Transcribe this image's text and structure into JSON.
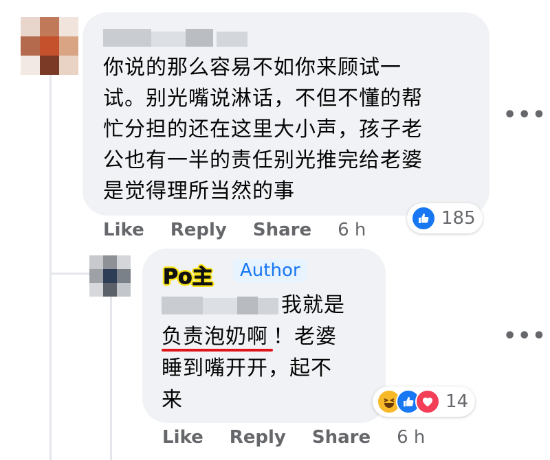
{
  "comment1": {
    "text": "你说的那么容易不如你来顾试一\n试。别光嘴说淋话，不但不懂的帮\n忙分担的还在这里大小声，孩子老\n公也有一半的责任别光推完给老婆\n是觉得理所当然的事",
    "reaction_count": "185",
    "reaction_icons": [
      "like-icon"
    ],
    "actions": {
      "like": "Like",
      "reply": "Reply",
      "share": "Share"
    },
    "time": "6 h",
    "more": "•••"
  },
  "comment2": {
    "tag": "Po主",
    "author_badge": "Author",
    "line1": "我就是",
    "underlined_text": "负责泡奶啊",
    "line2_rest": "！老婆",
    "line3": "睡到嘴开开，起不",
    "line4": "来",
    "reaction_count": "14",
    "reaction_icons": [
      "haha-icon",
      "like-icon",
      "love-icon"
    ],
    "actions": {
      "like": "Like",
      "reply": "Reply",
      "share": "Share"
    },
    "time": "6 h",
    "more": "•••"
  },
  "colors": {
    "bubble": "#f0f2f5",
    "like_blue": "#1877f2",
    "love_red": "#f33e58",
    "haha_yellow": "#f7b928",
    "author_badge_bg": "#e7f3ff",
    "underline": "#e0151b",
    "po_highlight": "#f9e41a"
  }
}
